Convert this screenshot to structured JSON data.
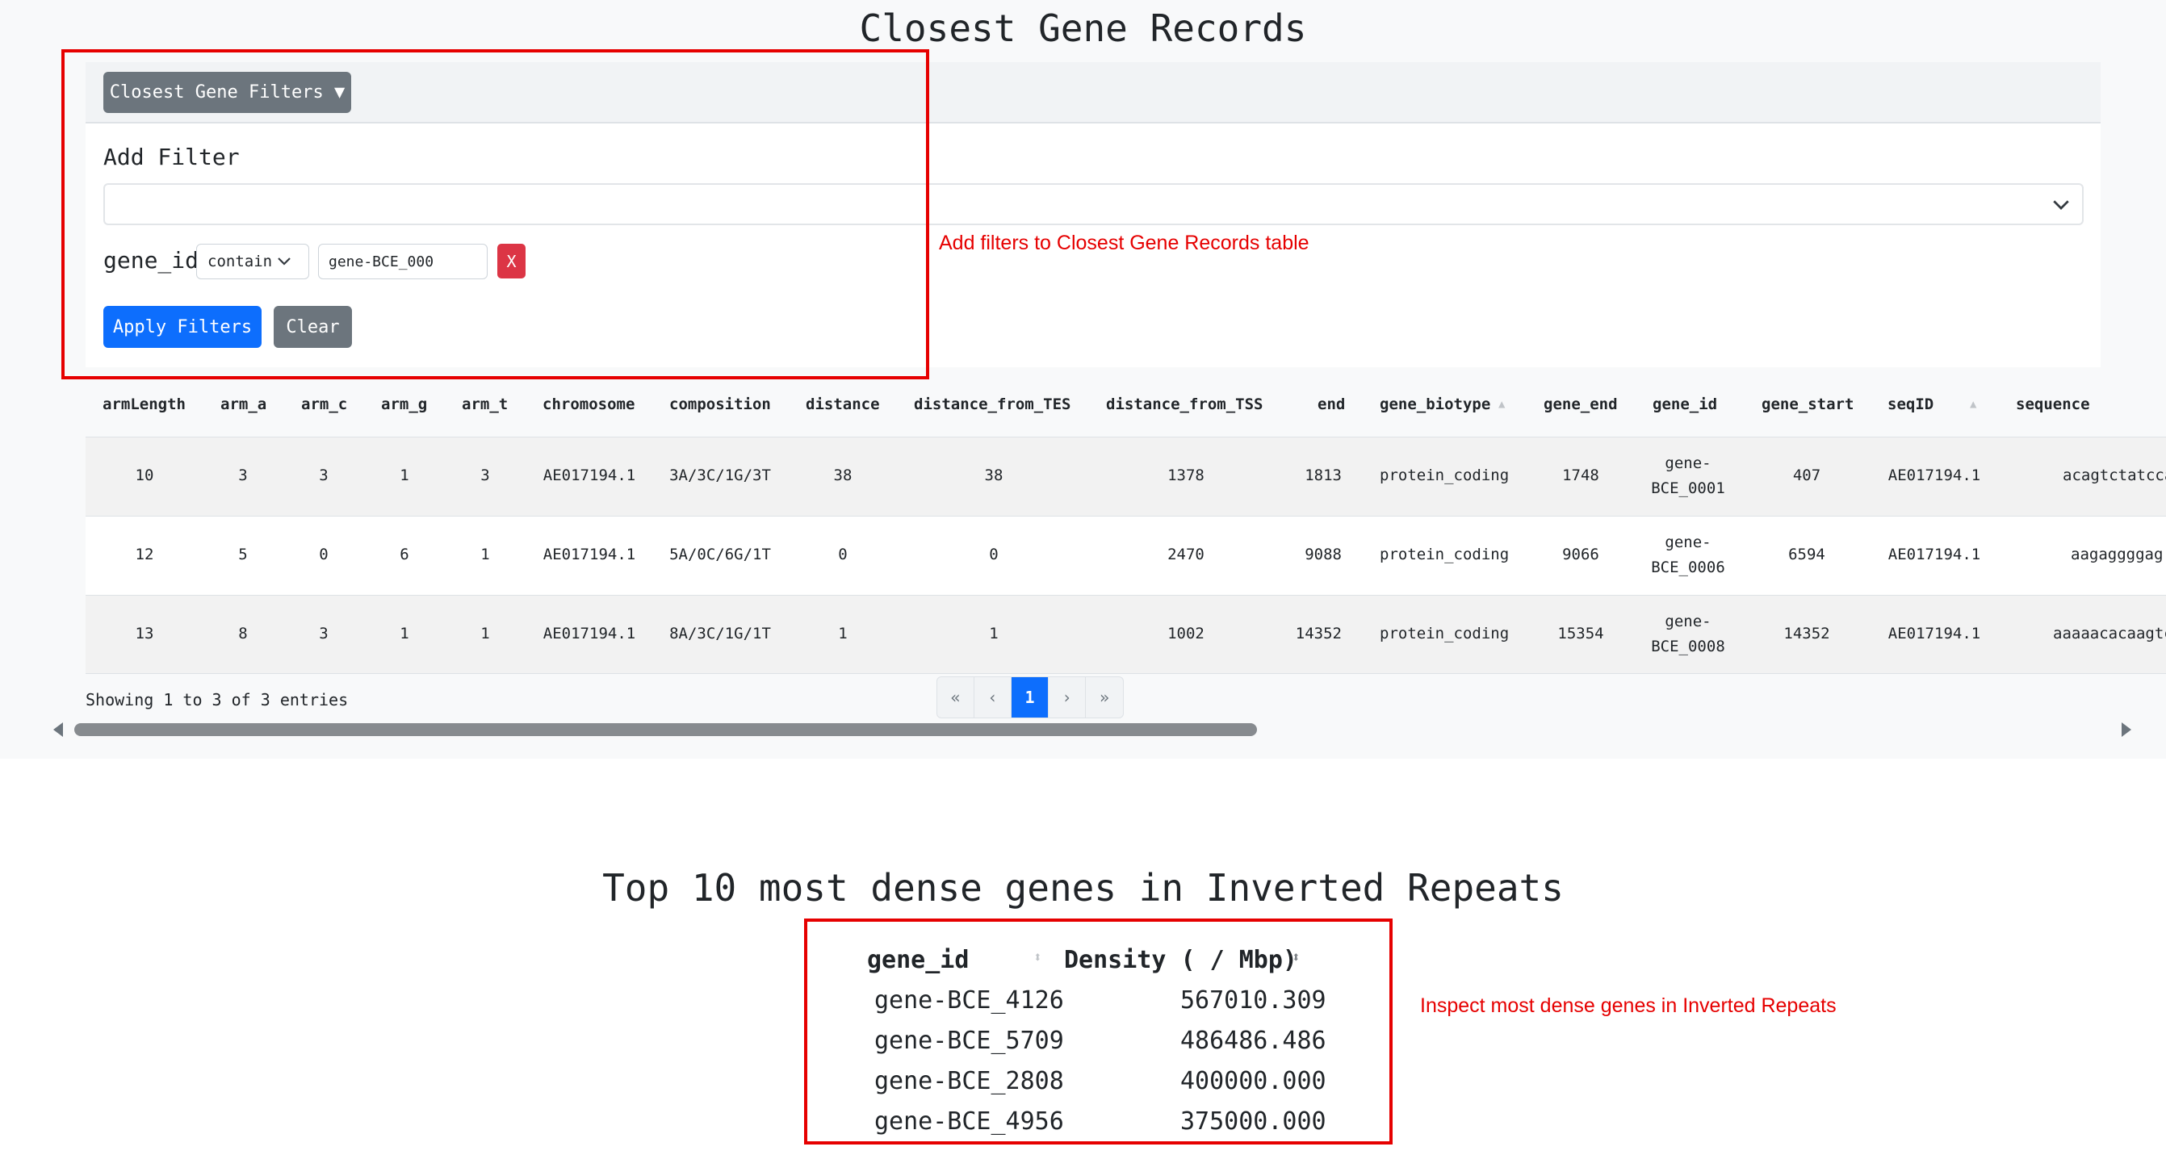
{
  "section1": {
    "title": "Closest Gene Records",
    "filter_panel": {
      "toggle_label": "Closest Gene Filters ▼",
      "add_filter_label": "Add Filter",
      "select_value": "",
      "filter": {
        "field": "gene_id",
        "operator": "contain",
        "value": "gene-BCE_000",
        "remove_label": "X"
      },
      "apply_label": "Apply Filters",
      "clear_label": "Clear"
    },
    "annotation": "Add filters to Closest Gene Records table",
    "table": {
      "columns": [
        "armLength",
        "arm_a",
        "arm_c",
        "arm_g",
        "arm_t",
        "chromosome",
        "composition",
        "distance",
        "distance_from_TES",
        "distance_from_TSS",
        "end",
        "gene_biotype",
        "gene_end",
        "gene_id",
        "gene_start",
        "seqID",
        "sequence"
      ],
      "rows": [
        {
          "armLength": "10",
          "arm_a": "3",
          "arm_c": "3",
          "arm_g": "1",
          "arm_t": "3",
          "chromosome": "AE017194.1",
          "composition": "3A/3C/1G/3T",
          "distance": "38",
          "distance_from_TES": "38",
          "distance_from_TSS": "1378",
          "end": "1813",
          "gene_biotype": "protein_coding",
          "gene_end": "1748",
          "gene_id_1": "gene-",
          "gene_id_2": "BCE_0001",
          "gene_start": "407",
          "seqID": "AE017194.1",
          "sequence": "acagtctatcca"
        },
        {
          "armLength": "12",
          "arm_a": "5",
          "arm_c": "0",
          "arm_g": "6",
          "arm_t": "1",
          "chromosome": "AE017194.1",
          "composition": "5A/0C/6G/1T",
          "distance": "0",
          "distance_from_TES": "0",
          "distance_from_TSS": "2470",
          "end": "9088",
          "gene_biotype": "protein_coding",
          "gene_end": "9066",
          "gene_id_1": "gene-",
          "gene_id_2": "BCE_0006",
          "gene_start": "6594",
          "seqID": "AE017194.1",
          "sequence": "aagaggggag"
        },
        {
          "armLength": "13",
          "arm_a": "8",
          "arm_c": "3",
          "arm_g": "1",
          "arm_t": "1",
          "chromosome": "AE017194.1",
          "composition": "8A/3C/1G/1T",
          "distance": "1",
          "distance_from_TES": "1",
          "distance_from_TSS": "1002",
          "end": "14352",
          "gene_biotype": "protein_coding",
          "gene_end": "15354",
          "gene_id_1": "gene-",
          "gene_id_2": "BCE_0008",
          "gene_start": "14352",
          "seqID": "AE017194.1",
          "sequence": "aaaaacacaagtc"
        }
      ],
      "info": "Showing 1 to 3 of 3 entries",
      "pagination": {
        "first": "«",
        "prev": "‹",
        "current": "1",
        "next": "›",
        "last": "»"
      }
    }
  },
  "section2": {
    "title": "Top 10 most dense genes in Inverted Repeats",
    "columns": [
      "gene_id",
      "Density ( / Mbp)"
    ],
    "rows": [
      {
        "gene_id": "gene-BCE_4126",
        "density": "567010.309"
      },
      {
        "gene_id": "gene-BCE_5709",
        "density": "486486.486"
      },
      {
        "gene_id": "gene-BCE_2808",
        "density": "400000.000"
      },
      {
        "gene_id": "gene-BCE_4956",
        "density": "375000.000"
      }
    ],
    "annotation": "Inspect most dense genes in Inverted Repeats"
  },
  "colors": {
    "primary": "#0d6efd",
    "secondary": "#6c757d",
    "danger": "#dc3545",
    "annotation": "#e60000"
  }
}
